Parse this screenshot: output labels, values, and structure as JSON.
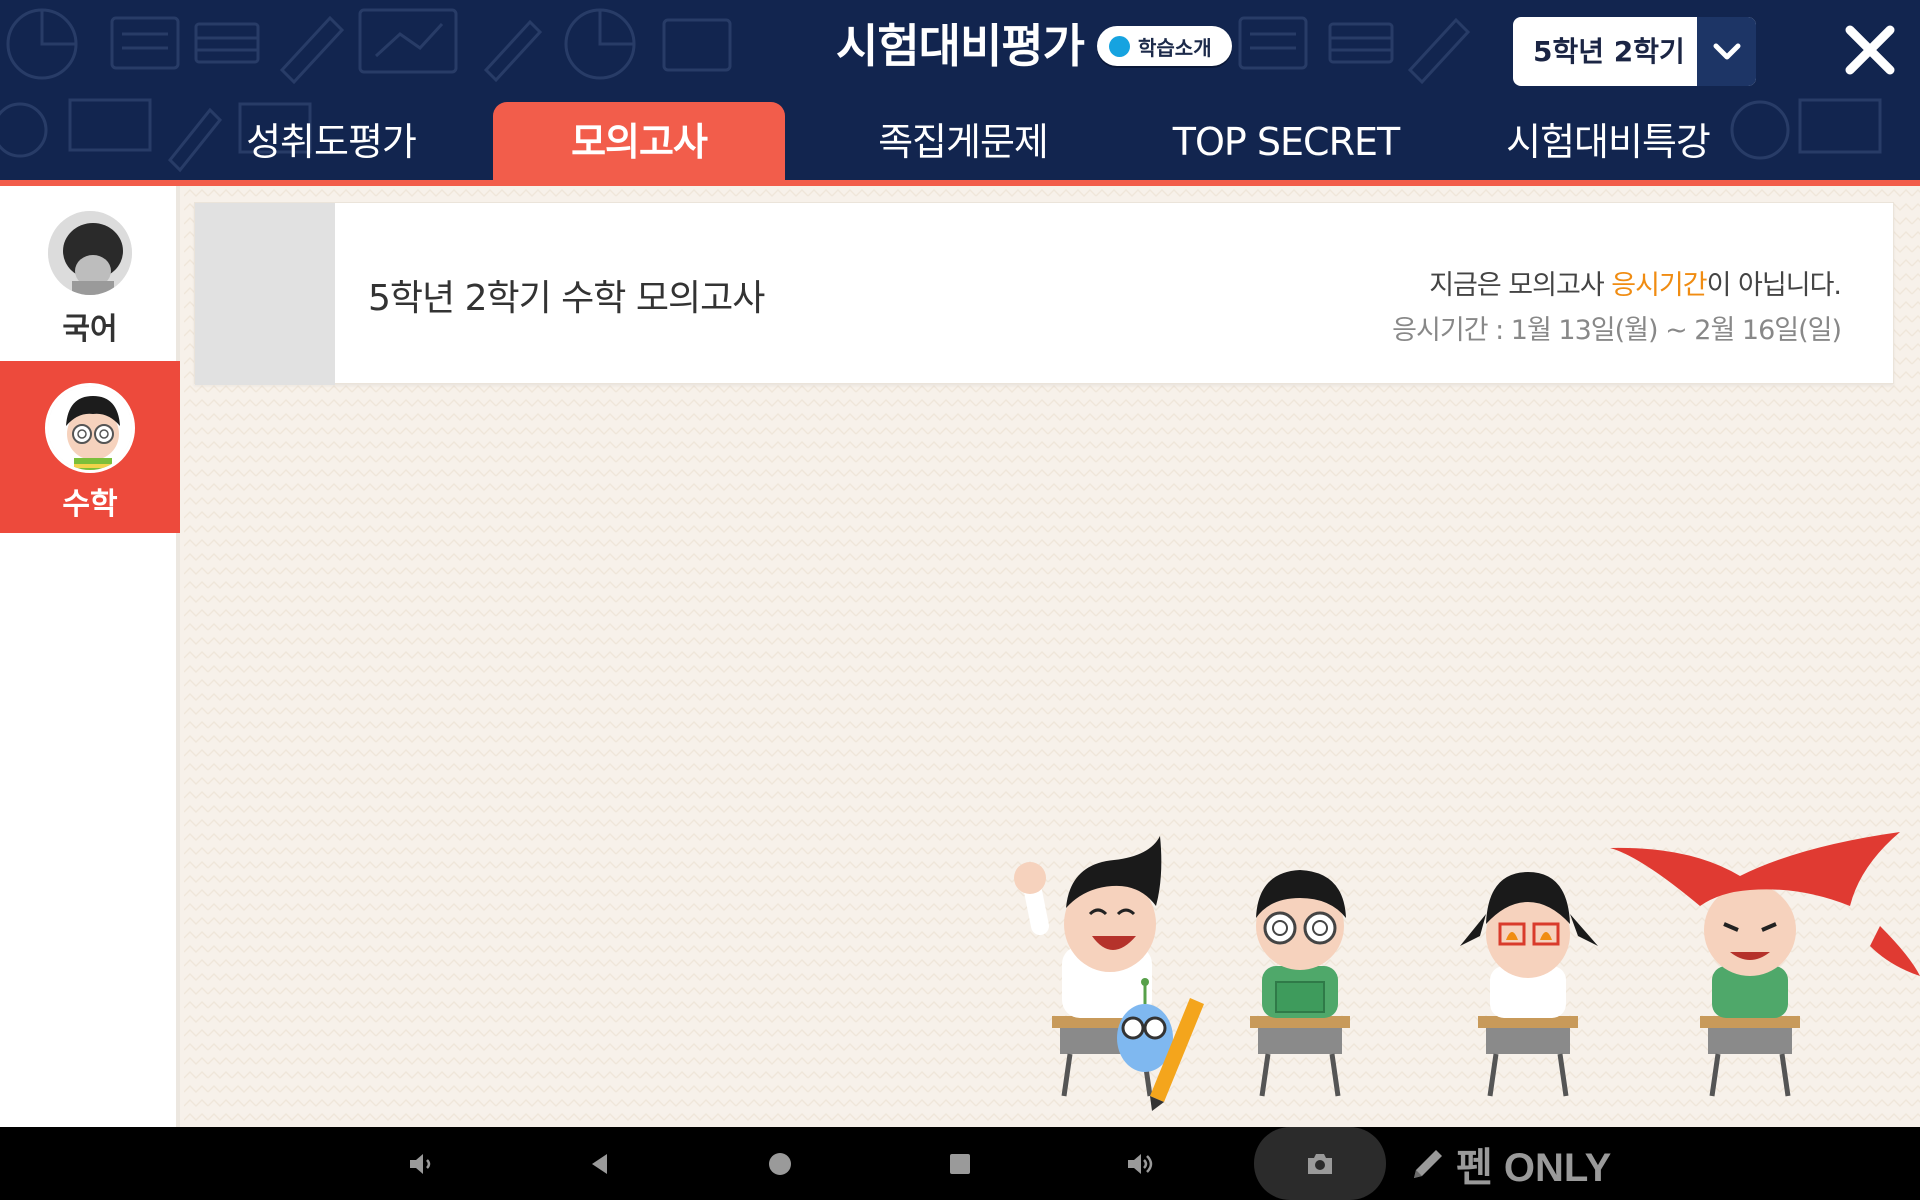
{
  "header": {
    "title": "시험대비평가",
    "intro_badge": "학습소개",
    "grade_selector": "5학년 2학기",
    "tabs": [
      {
        "label": "성취도평가",
        "active": false
      },
      {
        "label": "모의고사",
        "active": true
      },
      {
        "label": "족집게문제",
        "active": false
      },
      {
        "label": "TOP SECRET",
        "active": false
      },
      {
        "label": "시험대비특강",
        "active": false
      }
    ]
  },
  "sidebar": {
    "items": [
      {
        "label": "국어",
        "active": false
      },
      {
        "label": "수학",
        "active": true
      }
    ]
  },
  "exam_card": {
    "title": "5학년 2학기 수학 모의고사",
    "status_prefix": "지금은 모의고사 ",
    "status_highlight": "응시기간",
    "status_suffix": "이 아닙니다.",
    "period": "응시기간 : 1월 13일(월) ~ 2월 16일(일)"
  },
  "navbar": {
    "pen_only_label": "펜 ONLY"
  },
  "colors": {
    "header_bg": "#12254f",
    "accent": "#f25d4b",
    "highlight": "#f08c12",
    "sidebar_active": "#ed4a3c"
  },
  "icons": [
    "close-icon",
    "chevron-down-icon",
    "volume-down-icon",
    "back-icon",
    "home-icon",
    "recents-icon",
    "volume-up-icon",
    "camera-icon",
    "pencil-icon"
  ]
}
